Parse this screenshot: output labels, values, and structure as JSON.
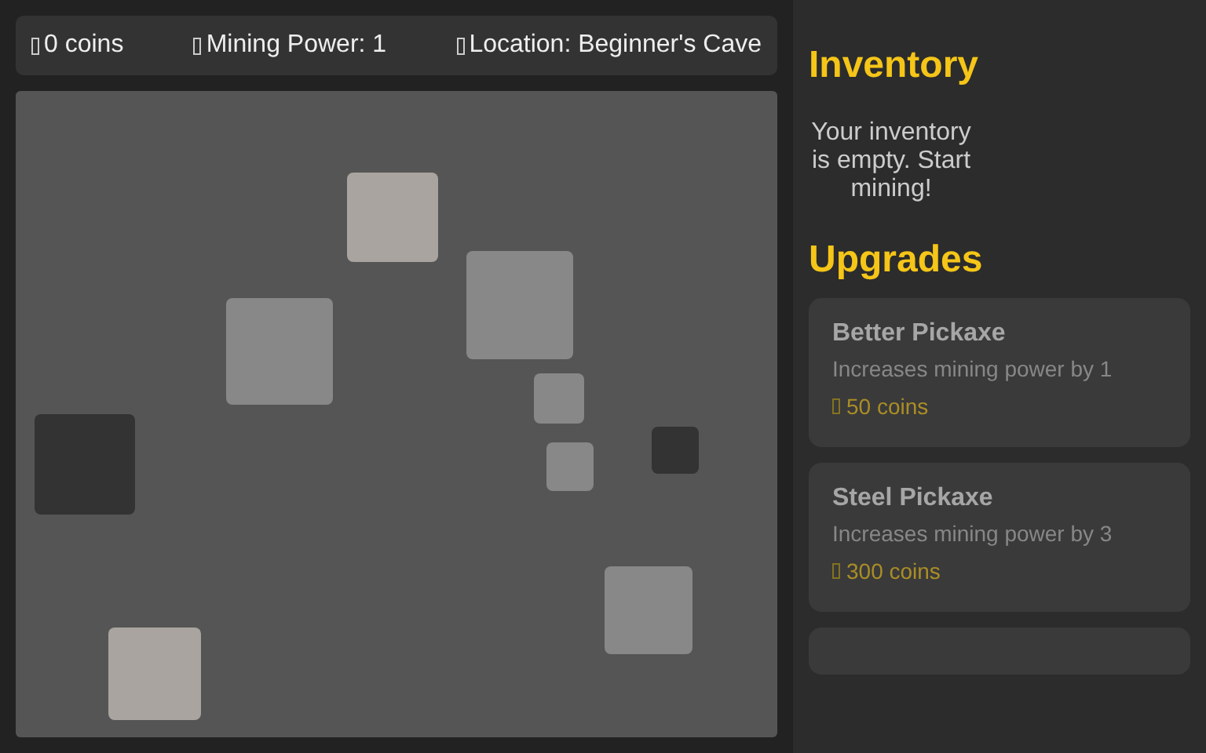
{
  "stats": [
    {
      "text": "0 coins"
    },
    {
      "text": "Mining Power: 1"
    },
    {
      "text": "Location: Beginner's Cave"
    }
  ],
  "rocks": [
    {
      "color": "#a9a49f"
    },
    {
      "color": "#888888"
    },
    {
      "color": "#888888"
    },
    {
      "color": "#888888"
    },
    {
      "color": "#333333"
    },
    {
      "color": "#333333"
    },
    {
      "color": "#888888"
    },
    {
      "color": "#888888"
    },
    {
      "color": "#a9a49f"
    }
  ],
  "inventory": {
    "title": "Inventory",
    "empty_message": "Your inventory is empty. Start mining!"
  },
  "upgrades": {
    "title": "Upgrades",
    "items": [
      {
        "name": "Better Pickaxe",
        "description": "Increases mining power by 1",
        "cost": "50 coins",
        "disabled": true
      },
      {
        "name": "Steel Pickaxe",
        "description": "Increases mining power by 3",
        "cost": "300 coins",
        "disabled": true
      }
    ]
  }
}
